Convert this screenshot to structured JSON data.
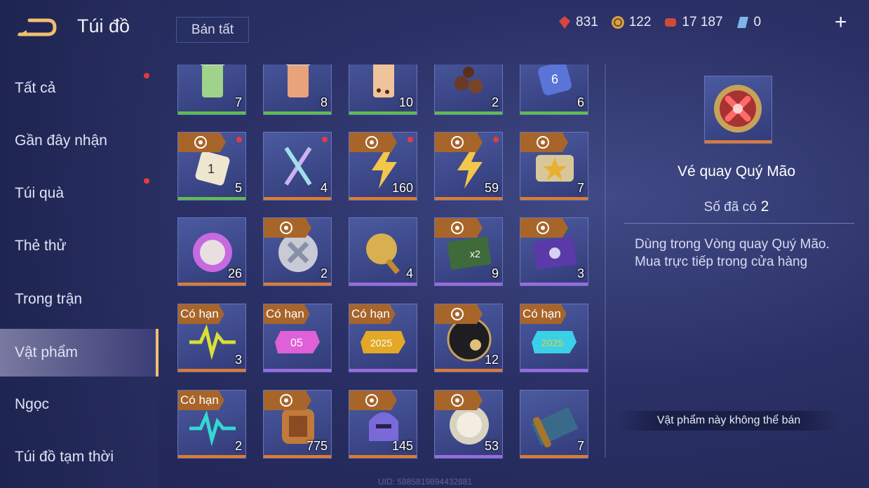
{
  "header": {
    "title": "Túi đồ",
    "sell_all_label": "Bán tất"
  },
  "currencies": [
    {
      "icon": "red-gem-icon",
      "value": "831"
    },
    {
      "icon": "gold-coin-icon",
      "value": "122"
    },
    {
      "icon": "red-voucher-icon",
      "value": "17 187"
    },
    {
      "icon": "blue-diamond-icon",
      "value": "0"
    }
  ],
  "sidebar": {
    "items": [
      {
        "label": "Tất cả",
        "dot": true,
        "active": false
      },
      {
        "label": "Gần đây nhận",
        "dot": false,
        "active": false
      },
      {
        "label": "Túi quà",
        "dot": true,
        "active": false
      },
      {
        "label": "Thẻ thử",
        "dot": false,
        "active": false
      },
      {
        "label": "Trong trận",
        "dot": false,
        "active": false
      },
      {
        "label": "Vật phẩm",
        "dot": false,
        "active": true
      },
      {
        "label": "Ngọc",
        "dot": false,
        "active": false
      },
      {
        "label": "Túi đồ tạm thời",
        "dot": false,
        "active": false
      }
    ]
  },
  "colors": {
    "green": "#5dbf4a",
    "orange": "#e07a2c",
    "purple": "#9a6ae0",
    "accent_gold": "#f0c070",
    "red_dot": "#e23d3d"
  },
  "items": [
    {
      "name": "green-tea-cup",
      "count": "7",
      "rarity": "green",
      "tag": "",
      "dot": false
    },
    {
      "name": "orange-tea-cup",
      "count": "8",
      "rarity": "green",
      "tag": "",
      "dot": false
    },
    {
      "name": "bubble-tea-cup",
      "count": "10",
      "rarity": "green",
      "tag": "",
      "dot": false
    },
    {
      "name": "chocolate-balls",
      "count": "2",
      "rarity": "green",
      "tag": "",
      "dot": false
    },
    {
      "name": "blue-dice",
      "count": "6",
      "rarity": "green",
      "tag": "",
      "dot": false
    },
    {
      "name": "white-dice",
      "count": "5",
      "rarity": "green",
      "tag": "coin",
      "dot": true
    },
    {
      "name": "light-sticks",
      "count": "4",
      "rarity": "orange",
      "tag": "",
      "dot": true
    },
    {
      "name": "lightning-bolt",
      "count": "160",
      "rarity": "orange",
      "tag": "coin",
      "dot": true
    },
    {
      "name": "lightning-bolt-small",
      "count": "59",
      "rarity": "orange",
      "tag": "coin",
      "dot": true
    },
    {
      "name": "star-ticket",
      "count": "7",
      "rarity": "orange",
      "tag": "coin",
      "dot": false
    },
    {
      "name": "purple-orb",
      "count": "26",
      "rarity": "orange",
      "tag": "",
      "dot": false
    },
    {
      "name": "silver-x-orb",
      "count": "2",
      "rarity": "orange",
      "tag": "coin",
      "dot": false
    },
    {
      "name": "golden-key-shield",
      "count": "4",
      "rarity": "purple",
      "tag": "",
      "dot": false
    },
    {
      "name": "x2-green-card",
      "count": "9",
      "rarity": "purple",
      "tag": "coin",
      "dot": false
    },
    {
      "name": "purple-card",
      "count": "3",
      "rarity": "purple",
      "tag": "coin",
      "dot": false
    },
    {
      "name": "yellow-pulse",
      "count": "3",
      "rarity": "orange",
      "tag": "Có hạn",
      "dot": false
    },
    {
      "name": "pink-05-badge",
      "count": "",
      "rarity": "purple",
      "tag": "Có hạn",
      "dot": false
    },
    {
      "name": "gold-2025-badge",
      "count": "",
      "rarity": "purple",
      "tag": "Có hạn",
      "dot": false
    },
    {
      "name": "tap-hand-coin",
      "count": "12",
      "rarity": "orange",
      "tag": "coin",
      "dot": false
    },
    {
      "name": "cyan-2025-badge",
      "count": "",
      "rarity": "purple",
      "tag": "Có hạn",
      "dot": false
    },
    {
      "name": "cyan-pulse",
      "count": "2",
      "rarity": "orange",
      "tag": "Có hạn",
      "dot": false
    },
    {
      "name": "bronze-armor",
      "count": "775",
      "rarity": "orange",
      "tag": "coin",
      "dot": false
    },
    {
      "name": "purple-helmet",
      "count": "145",
      "rarity": "orange",
      "tag": "coin",
      "dot": false
    },
    {
      "name": "silver-orb",
      "count": "53",
      "rarity": "purple",
      "tag": "coin",
      "dot": false
    },
    {
      "name": "scroll-map",
      "count": "7",
      "rarity": "orange",
      "tag": "",
      "dot": false
    }
  ],
  "detail": {
    "name": "Vé quay Quý Mão",
    "owned_label": "Số đã có",
    "owned_count": "2",
    "description_line1": "Dùng trong Vòng quay Quý Mão.",
    "description_line2": "Mua trực tiếp trong cửa hàng",
    "cannot_sell": "Vật phẩm này không thể bán"
  },
  "footer": {
    "uid": "UID: 5885819894432881"
  }
}
